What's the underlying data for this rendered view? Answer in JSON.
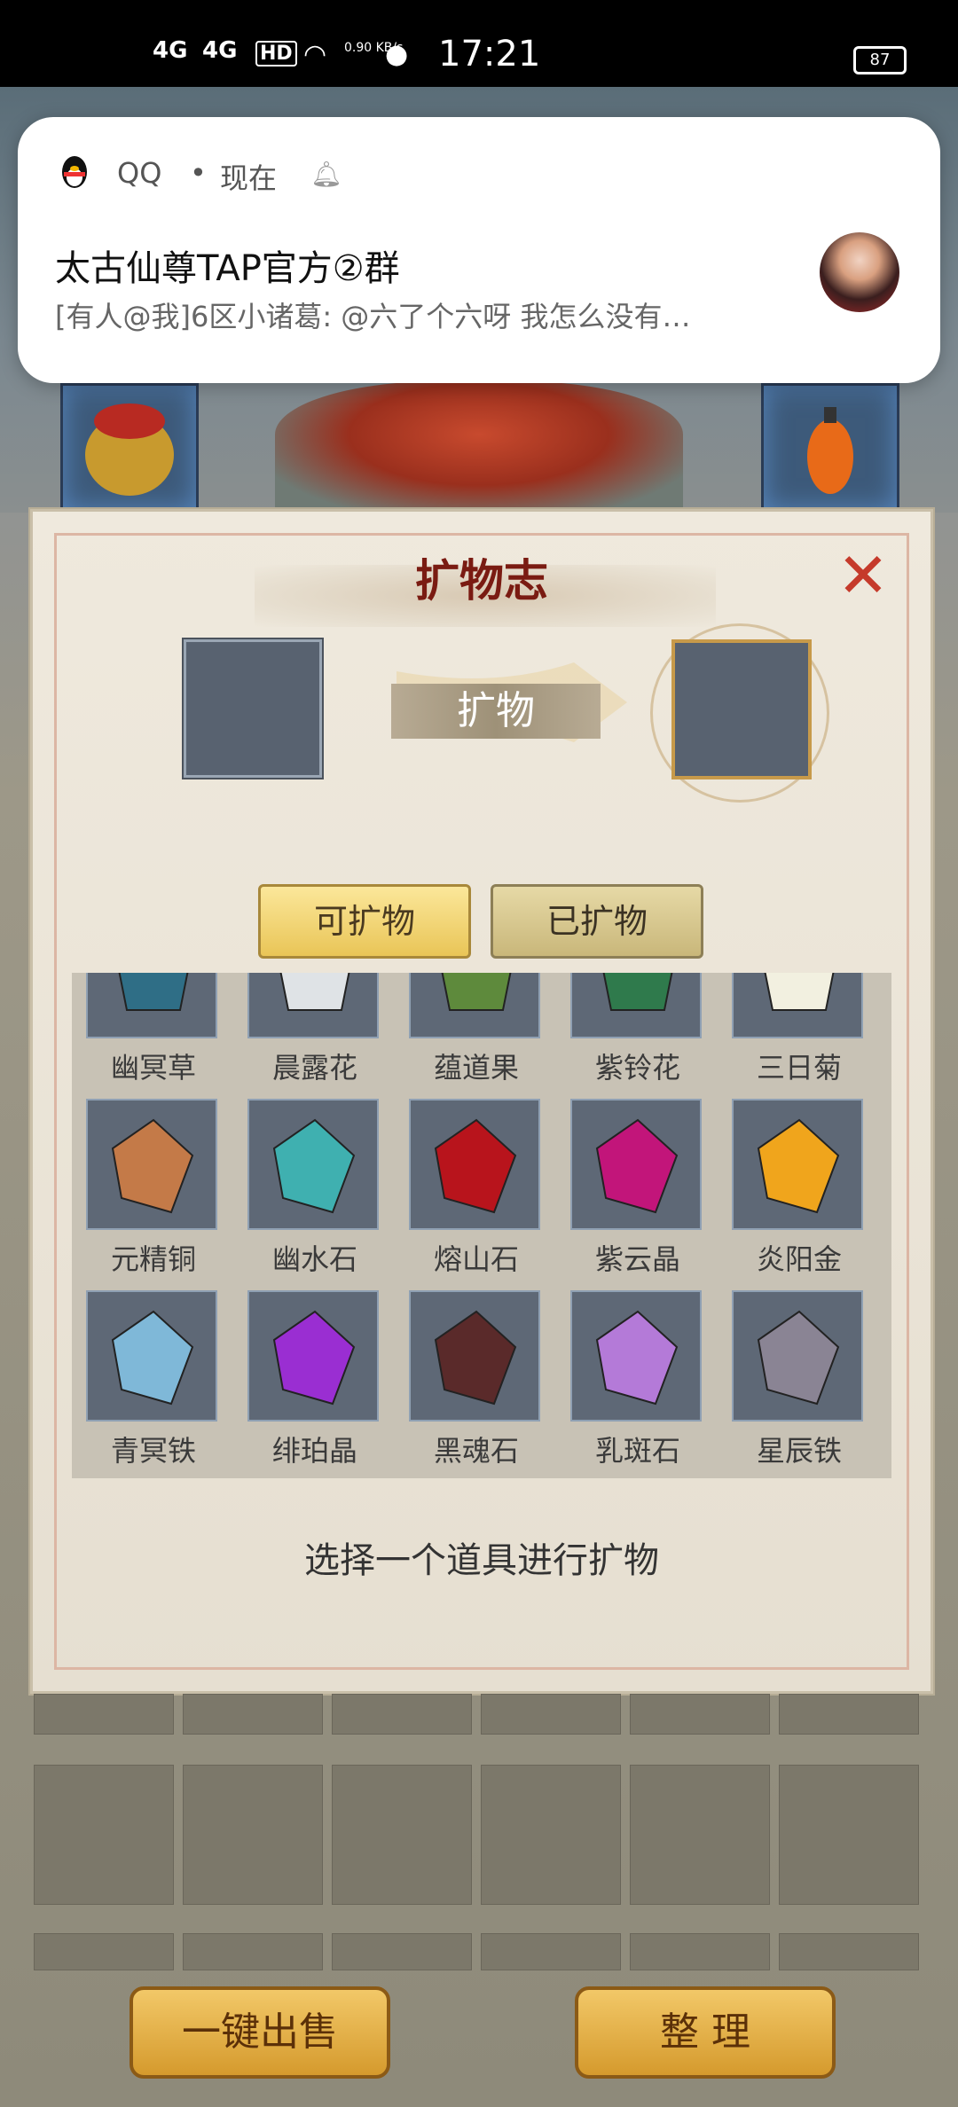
{
  "status_bar": {
    "signal_1": "4G",
    "signal_2": "4G",
    "hd": "HD",
    "net_speed": "0.90 KB/s",
    "time": "17:21",
    "battery": "87"
  },
  "notification": {
    "app": "QQ",
    "separator": "•",
    "time": "现在",
    "title": "太古仙尊TAP官方②群",
    "body": "[有人@我]6区小诸葛: @六了个六呀 我怎么没有…"
  },
  "dialog": {
    "title": "扩物志",
    "expand_label": "扩物",
    "tabs": [
      "可扩物",
      "已扩物"
    ],
    "hint": "选择一个道具进行扩物",
    "items": [
      {
        "name": "幽冥草",
        "color": "#2f6e86"
      },
      {
        "name": "晨露花",
        "color": "#dfe3e6"
      },
      {
        "name": "蕴道果",
        "color": "#5e8a3c"
      },
      {
        "name": "紫铃花",
        "color": "#2f7a4c"
      },
      {
        "name": "三日菊",
        "color": "#f2f0e0"
      },
      {
        "name": "元精铜",
        "color": "#c47a48"
      },
      {
        "name": "幽水石",
        "color": "#3fb0b0"
      },
      {
        "name": "熔山石",
        "color": "#b8141c"
      },
      {
        "name": "紫云晶",
        "color": "#c2157a"
      },
      {
        "name": "炎阳金",
        "color": "#f0a51c"
      },
      {
        "name": "青冥铁",
        "color": "#7fb8d8"
      },
      {
        "name": "绯珀晶",
        "color": "#9a2ed2"
      },
      {
        "name": "黑魂石",
        "color": "#5a2a2a"
      },
      {
        "name": "乳斑石",
        "color": "#b47ad8"
      },
      {
        "name": "星辰铁",
        "color": "#8a8494"
      }
    ]
  },
  "buttons": {
    "sell_all": "一键出售",
    "sort": "整 理"
  }
}
